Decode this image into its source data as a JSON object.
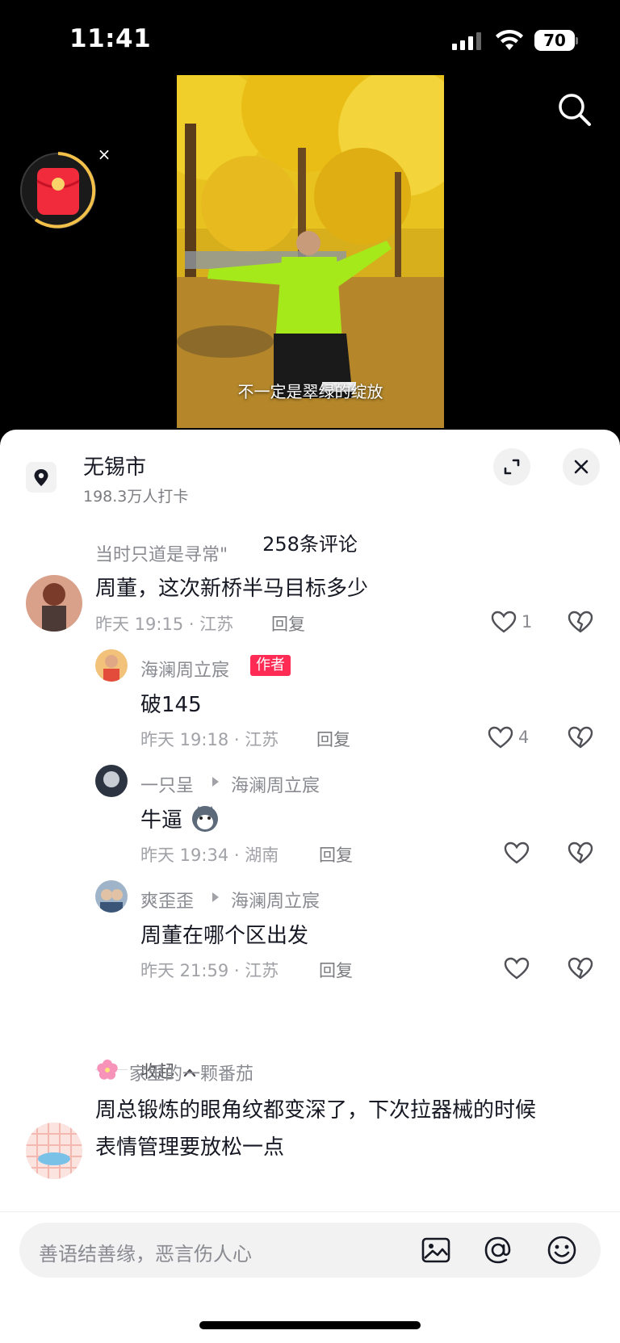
{
  "status": {
    "time": "11:41",
    "battery": "70"
  },
  "video": {
    "subtitle": "不一定是翠绿的绽放"
  },
  "location": {
    "name": "无锡市",
    "checkins": "198.3万人打卡"
  },
  "comments_count": "258条评论",
  "comments": [
    {
      "user": "当时只道是寻常\"",
      "text": "周董，这次新桥半马目标多少",
      "time": "昨天 19:15 · 江苏",
      "reply": "回复",
      "likes": "1"
    },
    {
      "user": "海澜周立宸",
      "tag": "作者",
      "text": "破145",
      "time": "昨天 19:18 · 江苏",
      "reply": "回复",
      "likes": "4"
    },
    {
      "user": "一只呈",
      "reply_to": "海澜周立宸",
      "text": "牛逼",
      "time": "昨天 19:34 · 湖南",
      "reply": "回复",
      "likes": ""
    },
    {
      "user": "爽歪歪",
      "reply_to": "海澜周立宸",
      "text": "周董在哪个区出发",
      "time": "昨天 21:59 · 江苏",
      "reply": "回复",
      "likes": ""
    },
    {
      "user": "家里的一颗番茄",
      "text": "周总锻炼的眼角纹都变深了，下次拉器械的时候",
      "text2": "表情管理要放松一点"
    }
  ],
  "collapse_label": "收起",
  "input": {
    "placeholder": "善语结善缘，恶言伤人心"
  },
  "colors": {
    "accent": "#fe2c55",
    "text": "#161823",
    "muted": "#8a8b91"
  },
  "icons": [
    "search-icon",
    "red-envelope-icon",
    "location-pin-icon",
    "expand-icon",
    "close-icon",
    "heart-icon",
    "broken-heart-icon",
    "image-icon",
    "at-icon",
    "emoji-icon"
  ]
}
